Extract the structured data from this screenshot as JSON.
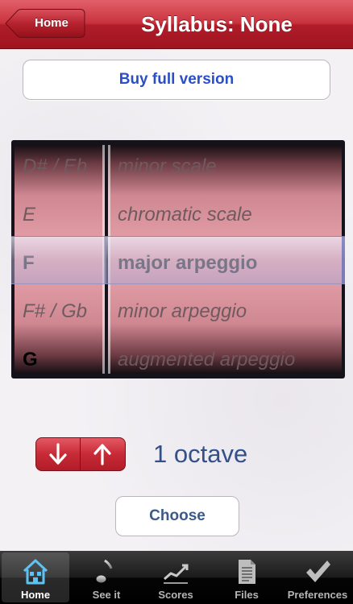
{
  "navbar": {
    "home_label": "Home",
    "title": "Syllabus: None"
  },
  "buy_button": {
    "label": "Buy full version"
  },
  "picker": {
    "notes": [
      "D# / Eb",
      "E",
      "F",
      "F# / Gb",
      "G"
    ],
    "types": [
      "minor scale",
      "chromatic scale",
      "major arpeggio",
      "minor arpeggio",
      "augmented arpeggio"
    ],
    "selected_index": 2
  },
  "octave": {
    "label": "1 octave"
  },
  "choose_button": {
    "label": "Choose"
  },
  "tabbar": {
    "tabs": [
      {
        "label": "Home",
        "icon": "house-icon",
        "active": true
      },
      {
        "label": "See it",
        "icon": "music-note-icon",
        "active": false
      },
      {
        "label": "Scores",
        "icon": "line-chart-icon",
        "active": false
      },
      {
        "label": "Files",
        "icon": "document-icon",
        "active": false
      },
      {
        "label": "Preferences",
        "icon": "checkmark-icon",
        "active": false
      }
    ]
  },
  "colors": {
    "nav_red": "#c8323d",
    "accent_blue": "#2a4fc7",
    "picker_pink": "#e09ba4"
  }
}
